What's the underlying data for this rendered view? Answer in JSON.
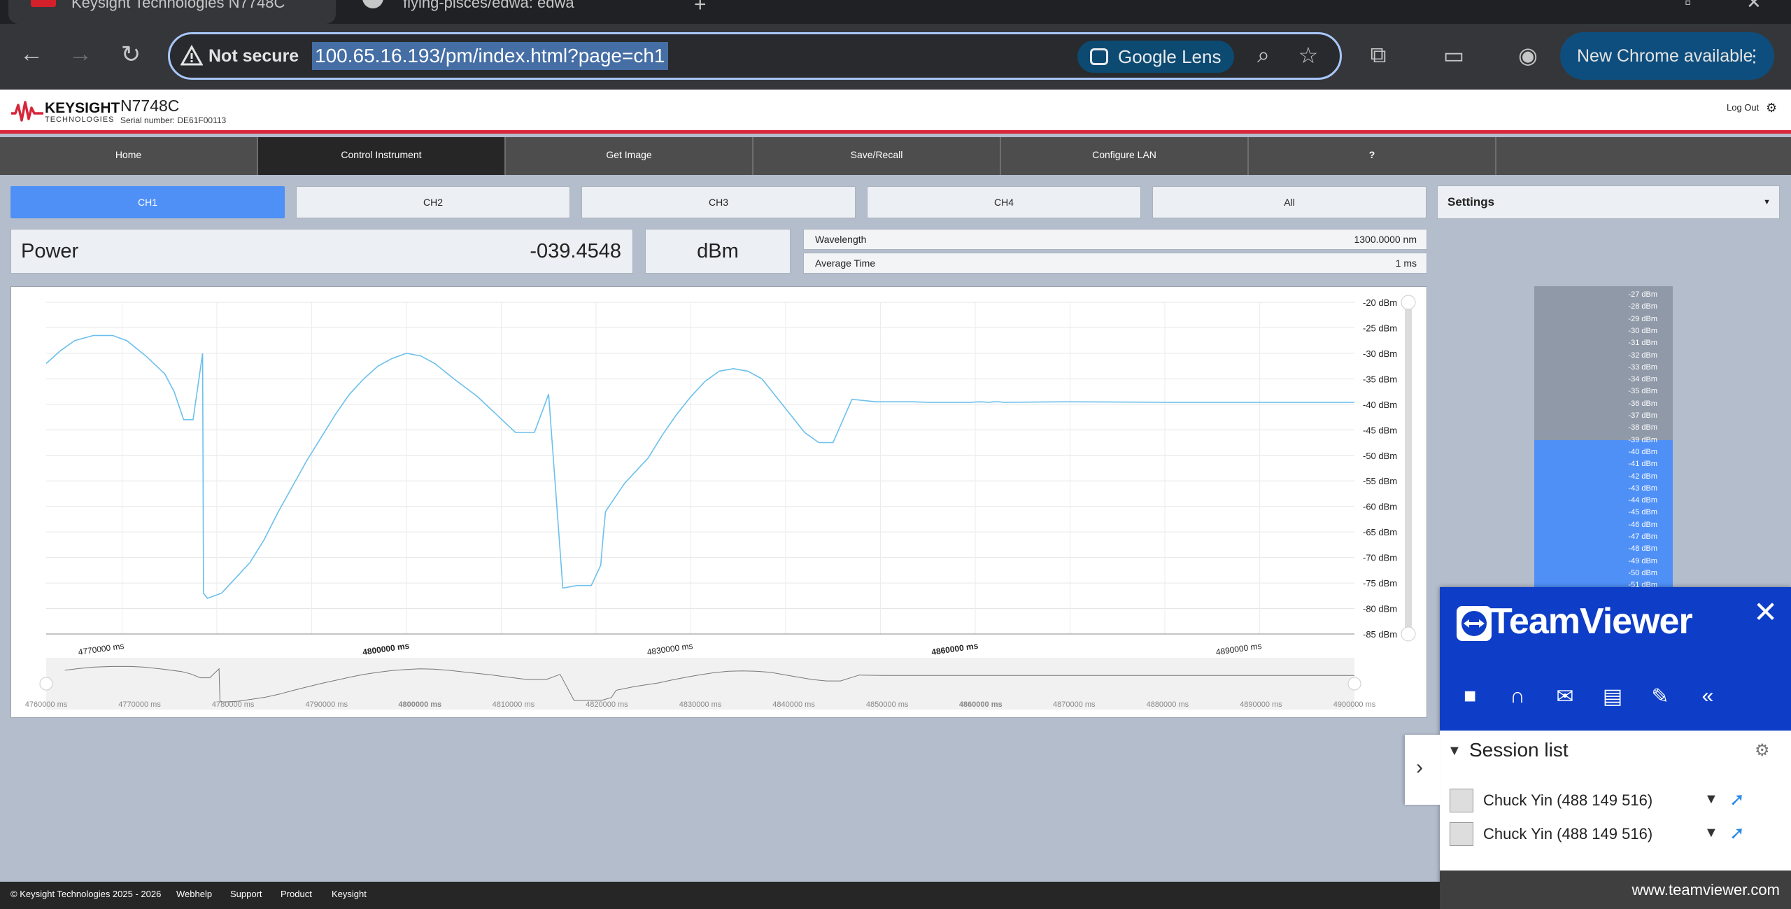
{
  "browser": {
    "tab1": "Keysight Technologies N7748C",
    "tab2": "flying-pisces/edwa: edwa",
    "not_secure": "Not secure",
    "url": "100.65.16.193/pm/index.html?page=ch1",
    "lens": "Google Lens",
    "new_chrome": "New Chrome available"
  },
  "header": {
    "brand_line1": "KEYSIGHT",
    "brand_line2": "TECHNOLOGIES",
    "model": "N7748C",
    "serial": "Serial number: DE61F00113",
    "logout": "Log Out"
  },
  "nav": [
    "Home",
    "Control Instrument",
    "Get Image",
    "Save/Recall",
    "Configure LAN",
    "?"
  ],
  "channels": [
    "CH1",
    "CH2",
    "CH3",
    "CH4",
    "All"
  ],
  "settings_label": "Settings",
  "power": {
    "label": "Power",
    "value": "-039.4548",
    "unit": "dBm"
  },
  "params": {
    "wavelength_label": "Wavelength",
    "wavelength_value": "1300.0000 nm",
    "avg_label": "Average Time",
    "avg_value": "1 ms"
  },
  "chart_data": {
    "type": "line",
    "x_unit": "ms",
    "y_unit": "dBm",
    "xlim": [
      4762000,
      4900000
    ],
    "ylim": [
      -85,
      -20
    ],
    "x_ticks": [
      "4770000 ms",
      "4800000 ms",
      "4830000 ms",
      "4860000 ms",
      "4890000 ms"
    ],
    "y_ticks": [
      "-20 dBm",
      "-25 dBm",
      "-30 dBm",
      "-35 dBm",
      "-40 dBm",
      "-45 dBm",
      "-50 dBm",
      "-55 dBm",
      "-60 dBm",
      "-65 dBm",
      "-70 dBm",
      "-75 dBm",
      "-80 dBm",
      "-85 dBm"
    ],
    "navigator_ticks": [
      "4760000 ms",
      "4770000 ms",
      "4780000 ms",
      "4790000 ms",
      "4800000 ms",
      "4810000 ms",
      "4820000 ms",
      "4830000 ms",
      "4840000 ms",
      "4850000 ms",
      "4860000 ms",
      "4870000 ms",
      "4880000 ms",
      "4890000 ms",
      "4900000 ms"
    ],
    "series": [
      {
        "x": [
          4762000,
          4763500,
          4765000,
          4767000,
          4769000,
          4770500,
          4772500,
          4774500,
          4775500,
          4776500,
          4777500,
          4778500,
          4778600,
          4779000,
          4780500,
          4782000,
          4783500,
          4785000,
          4786500,
          4788000,
          4789500,
          4791000,
          4792500,
          4794000,
          4795500,
          4797000,
          4798500,
          4800000,
          4801500,
          4803000,
          4805000,
          4807500,
          4809500,
          4811500,
          4813500,
          4815000,
          4816500,
          4818000,
          4819500,
          4820500,
          4820700,
          4821000,
          4823000,
          4825500,
          4827000,
          4828500,
          4830000,
          4831500,
          4833000,
          4834500,
          4836000,
          4837500,
          4839000,
          4840500,
          4842000,
          4843500,
          4845000,
          4847000,
          4849500,
          4851500,
          4853500,
          4855000,
          4856500,
          4858000,
          4859500,
          4860500,
          4861500,
          4862000,
          4862500,
          4863000,
          4870000,
          4880000,
          4890000,
          4900000
        ],
        "y": [
          -32,
          -29.5,
          -27.5,
          -26.5,
          -26.5,
          -27.5,
          -30.5,
          -34,
          -37.5,
          -43,
          -43,
          -30,
          -77,
          -78,
          -77,
          -74,
          -71,
          -66.5,
          -61,
          -56,
          -51,
          -46.5,
          -42,
          -38,
          -35,
          -32.5,
          -31,
          -30,
          -30.5,
          -32,
          -35,
          -38.5,
          -42,
          -45.5,
          -45.5,
          -38,
          -76,
          -75.5,
          -75.5,
          -71.5,
          -67,
          -61,
          -55.5,
          -50.5,
          -46,
          -42,
          -38.5,
          -35.5,
          -33.5,
          -33,
          -33.5,
          -35,
          -38.5,
          -42,
          -45.5,
          -47.5,
          -47.5,
          -39,
          -39.5,
          -39.5,
          -39.5,
          -39.6,
          -39.6,
          -39.6,
          -39.6,
          -39.5,
          -39.6,
          -39.5,
          -39.5,
          -39.6,
          -39.5,
          -39.6,
          -39.6,
          -39.6
        ]
      }
    ]
  },
  "meter": {
    "labels": [
      "-27 dBm",
      "-28 dBm",
      "-29 dBm",
      "-30 dBm",
      "-31 dBm",
      "-32 dBm",
      "-33 dBm",
      "-34 dBm",
      "-35 dBm",
      "-36 dBm",
      "-37 dBm",
      "-38 dBm",
      "-39 dBm",
      "-40 dBm",
      "-41 dBm",
      "-42 dBm",
      "-43 dBm",
      "-44 dBm",
      "-45 dBm",
      "-46 dBm",
      "-47 dBm",
      "-48 dBm",
      "-49 dBm",
      "-50 dBm",
      "-51 dBm"
    ],
    "level_dbm": -39.45
  },
  "teamviewer": {
    "title": "TeamViewer",
    "session_list": "Session list",
    "sessions": [
      "Chuck Yin (488 149 516)",
      "Chuck Yin (488 149 516)"
    ],
    "footer": "www.teamviewer.com"
  },
  "footer": {
    "copyright": "© Keysight Technologies 2025 - 2026",
    "links": [
      "Webhelp",
      "Support",
      "Product",
      "Keysight"
    ]
  },
  "colors": {
    "accent_blue": "#4f90f7",
    "keysight_red": "#d8263a",
    "trace": "#6cc0ec",
    "teamviewer_blue": "#0e3ec8"
  }
}
